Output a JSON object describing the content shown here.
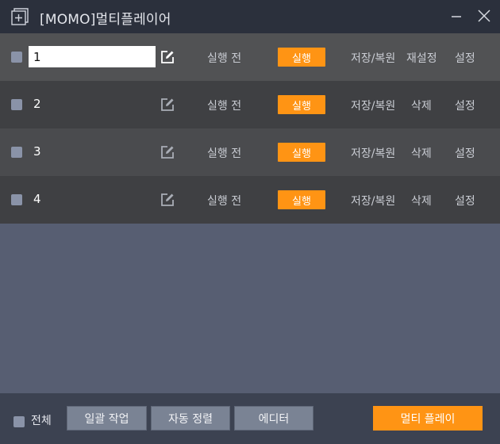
{
  "window": {
    "title": "[MOMO]멀티플레이어",
    "app_icon": "plus-square-icon",
    "minimize_icon": "minimize-icon",
    "close_icon": "close-icon"
  },
  "rows": [
    {
      "name": "1",
      "editing": true,
      "status": "실행 전",
      "run_label": "실행",
      "save_label": "저장/복원",
      "action_label": "재설정",
      "settings_label": "설정"
    },
    {
      "name": "2",
      "editing": false,
      "status": "실행 전",
      "run_label": "실행",
      "save_label": "저장/복원",
      "action_label": "삭제",
      "settings_label": "설정"
    },
    {
      "name": "3",
      "editing": false,
      "status": "실행 전",
      "run_label": "실행",
      "save_label": "저장/복원",
      "action_label": "삭제",
      "settings_label": "설정"
    },
    {
      "name": "4",
      "editing": false,
      "status": "실행 전",
      "run_label": "실행",
      "save_label": "저장/복원",
      "action_label": "삭제",
      "settings_label": "설정"
    }
  ],
  "footer": {
    "select_all_label": "전체",
    "batch_label": "일괄 작업",
    "sort_label": "자동 정렬",
    "editor_label": "에디터",
    "multi_play_label": "멀티 플레이"
  },
  "colors": {
    "accent": "#ff9414",
    "titlebar": "#2b303c",
    "body": "#575e72",
    "footer": "#3c4251"
  }
}
